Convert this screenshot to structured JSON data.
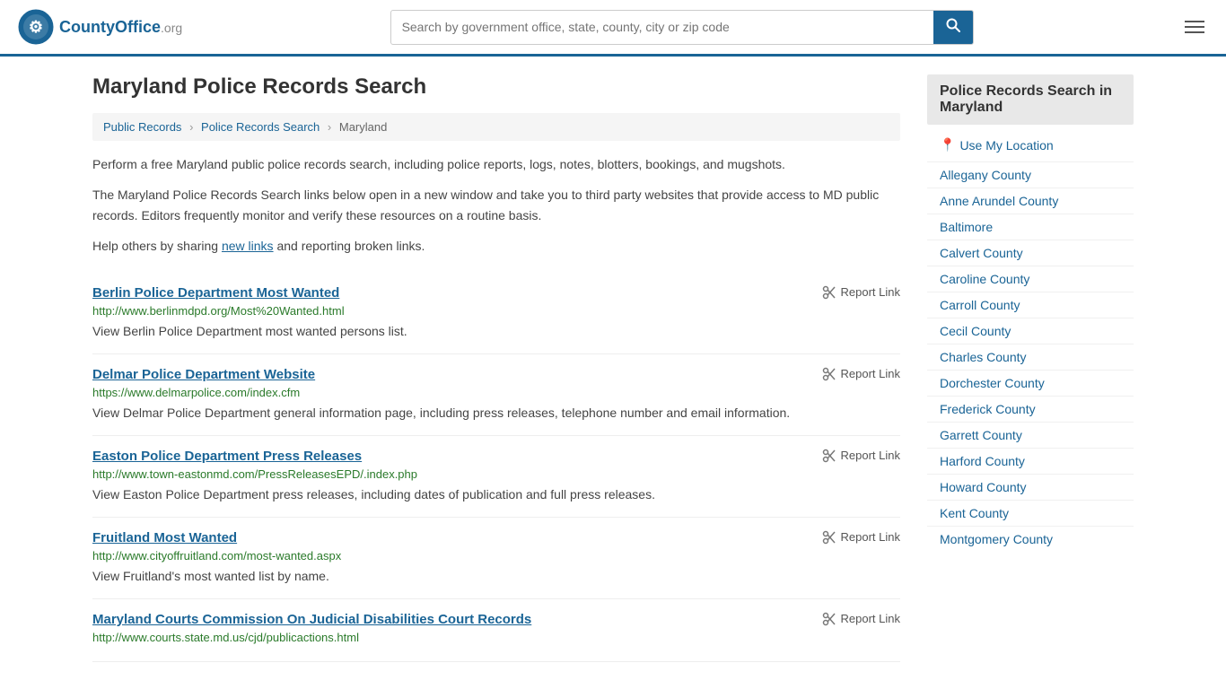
{
  "header": {
    "logo_text": "CountyOffice",
    "logo_suffix": ".org",
    "search_placeholder": "Search by government office, state, county, city or zip code",
    "search_button_label": "🔍"
  },
  "page": {
    "title": "Maryland Police Records Search",
    "breadcrumb": {
      "items": [
        "Public Records",
        "Police Records Search",
        "Maryland"
      ]
    },
    "description1": "Perform a free Maryland public police records search, including police reports, logs, notes, blotters, bookings, and mugshots.",
    "description2": "The Maryland Police Records Search links below open in a new window and take you to third party websites that provide access to MD public records. Editors frequently monitor and verify these resources on a routine basis.",
    "description3_pre": "Help others by sharing ",
    "description3_link": "new links",
    "description3_post": " and reporting broken links."
  },
  "records": [
    {
      "title": "Berlin Police Department Most Wanted",
      "url": "http://www.berlinmdpd.org/Most%20Wanted.html",
      "description": "View Berlin Police Department most wanted persons list.",
      "report_label": "Report Link"
    },
    {
      "title": "Delmar Police Department Website",
      "url": "https://www.delmarpolice.com/index.cfm",
      "description": "View Delmar Police Department general information page, including press releases, telephone number and email information.",
      "report_label": "Report Link"
    },
    {
      "title": "Easton Police Department Press Releases",
      "url": "http://www.town-eastonmd.com/PressReleasesEPD/.index.php",
      "description": "View Easton Police Department press releases, including dates of publication and full press releases.",
      "report_label": "Report Link"
    },
    {
      "title": "Fruitland Most Wanted",
      "url": "http://www.cityoffruitland.com/most-wanted.aspx",
      "description": "View Fruitland's most wanted list by name.",
      "report_label": "Report Link"
    },
    {
      "title": "Maryland Courts Commission On Judicial Disabilities Court Records",
      "url": "http://www.courts.state.md.us/cjd/publicactions.html",
      "description": "",
      "report_label": "Report Link"
    }
  ],
  "sidebar": {
    "title": "Police Records Search in Maryland",
    "use_location": "Use My Location",
    "counties": [
      "Allegany County",
      "Anne Arundel County",
      "Baltimore",
      "Calvert County",
      "Caroline County",
      "Carroll County",
      "Cecil County",
      "Charles County",
      "Dorchester County",
      "Frederick County",
      "Garrett County",
      "Harford County",
      "Howard County",
      "Kent County",
      "Montgomery County"
    ]
  }
}
